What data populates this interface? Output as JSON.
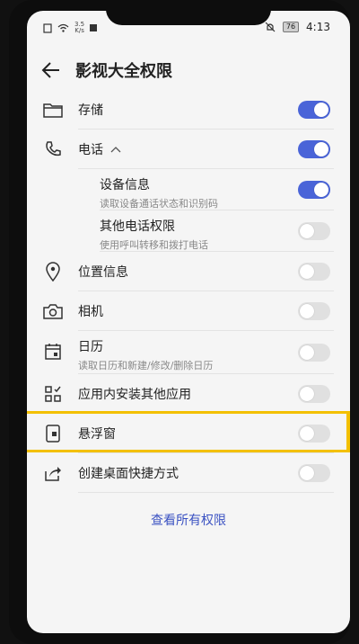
{
  "status_bar": {
    "speed_value": "3.5",
    "speed_unit": "K/s",
    "battery": "76",
    "time": "4:13"
  },
  "header": {
    "title": "影视大全权限",
    "back_icon": "arrow-left-icon"
  },
  "permissions": [
    {
      "label": "存储",
      "icon": "folder-icon",
      "enabled": true
    },
    {
      "label": "电话",
      "icon": "phone-icon",
      "enabled": true,
      "expanded": true
    },
    {
      "label": "设备信息",
      "description": "读取设备通话状态和识别码",
      "enabled": true
    },
    {
      "label": "其他电话权限",
      "description": "使用呼叫转移和拨打电话",
      "enabled": false
    },
    {
      "label": "位置信息",
      "icon": "location-pin-icon",
      "enabled": false
    },
    {
      "label": "相机",
      "icon": "camera-icon",
      "enabled": false
    },
    {
      "label": "日历",
      "description": "读取日历和新建/修改/删除日历",
      "icon": "calendar-icon",
      "enabled": false
    },
    {
      "label": "应用内安装其他应用",
      "icon": "app-grid-icon",
      "enabled": false
    },
    {
      "label": "悬浮窗",
      "icon": "floating-window-icon",
      "enabled": false,
      "highlighted": true
    },
    {
      "label": "创建桌面快捷方式",
      "icon": "shortcut-share-icon",
      "enabled": false
    }
  ],
  "footer": {
    "view_all_label": "查看所有权限"
  },
  "colors": {
    "accent": "#4a64d8",
    "highlight": "#f3c000",
    "toggle_off": "#e0e0e0"
  }
}
